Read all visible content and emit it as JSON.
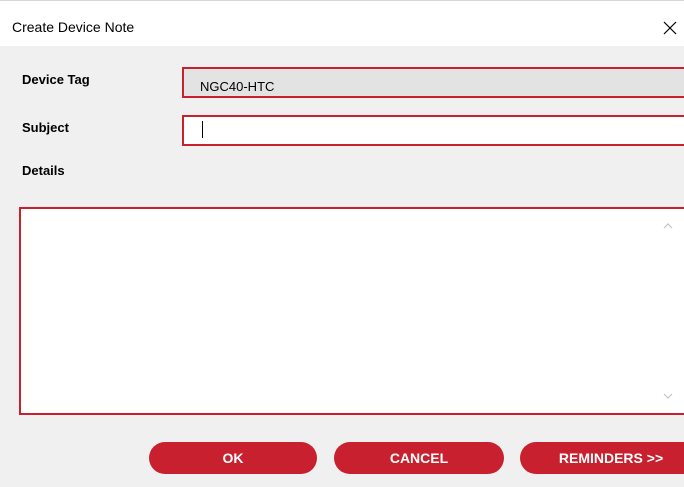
{
  "window": {
    "title": "Create Device Note",
    "close_icon": "close-icon"
  },
  "form": {
    "device_tag_label": "Device Tag",
    "device_tag_value": "NGC40-HTC",
    "subject_label": "Subject",
    "subject_value": "",
    "details_label": "Details",
    "details_value": ""
  },
  "buttons": {
    "ok": "OK",
    "cancel": "CANCEL",
    "reminders": "REMINDERS >>"
  },
  "colors": {
    "accent": "#c8202e",
    "background": "#f0f0f0",
    "readonly_field": "#e3e3e3"
  }
}
